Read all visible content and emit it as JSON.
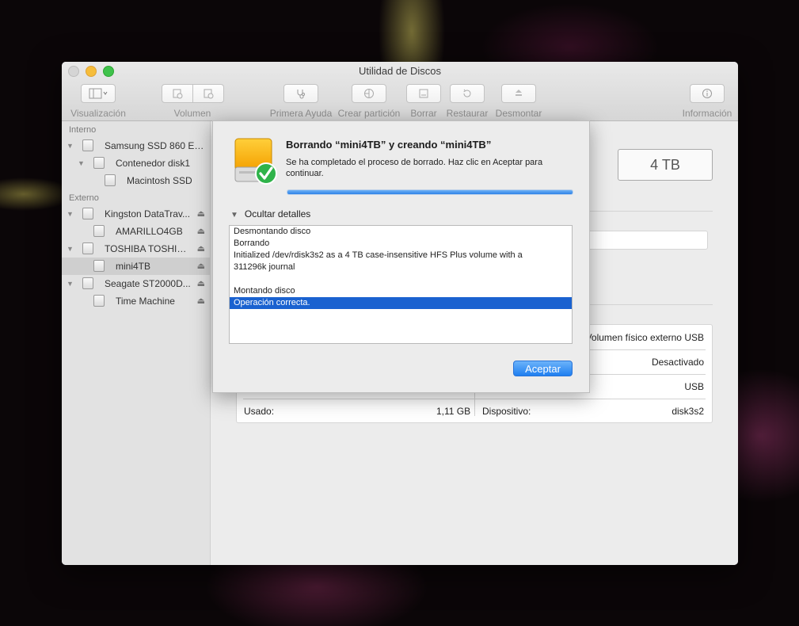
{
  "window": {
    "title": "Utilidad de Discos"
  },
  "toolbar": {
    "view_label": "Visualización",
    "volume_label": "Volumen",
    "first_aid_label": "Primera Ayuda",
    "partition_label": "Crear partición",
    "erase_label": "Borrar",
    "restore_label": "Restaurar",
    "unmount_label": "Desmontar",
    "info_label": "Información"
  },
  "sidebar": {
    "internal_header": "Interno",
    "external_header": "Externo",
    "items": [
      {
        "label": "Samsung SSD 860 EV..."
      },
      {
        "label": "Contenedor disk1"
      },
      {
        "label": "Macintosh SSD"
      },
      {
        "label": "Kingston DataTrav..."
      },
      {
        "label": "AMARILLO4GB"
      },
      {
        "label": "TOSHIBA TOSHIBA..."
      },
      {
        "label": "mini4TB"
      },
      {
        "label": "Seagate ST2000D..."
      },
      {
        "label": "Time Machine"
      }
    ]
  },
  "main": {
    "capacity": "4 TB",
    "info": {
      "connection_value": "Volumen físico externo USB",
      "status_value": "Desactivado",
      "bus_value": "USB",
      "used_label": "Usado:",
      "used_value": "1,11 GB",
      "device_label": "Dispositivo:",
      "device_value": "disk3s2"
    }
  },
  "dialog": {
    "title": "Borrando “mini4TB” y creando “mini4TB”",
    "message": "Se ha completado el proceso de borrado. Haz clic en Aceptar para continuar.",
    "progress": 1.0,
    "details_toggle": "Ocultar detalles",
    "log": [
      "Desmontando disco",
      "Borrando",
      "Initialized /dev/rdisk3s2 as a 4 TB case-insensitive HFS Plus volume with a",
      "311296k journal",
      "",
      "Montando disco",
      "Operación correcta."
    ],
    "ok_label": "Aceptar"
  },
  "colors": {
    "accent": "#1f7ff0",
    "selection": "#1a62d0",
    "success": "#2fb34a"
  }
}
